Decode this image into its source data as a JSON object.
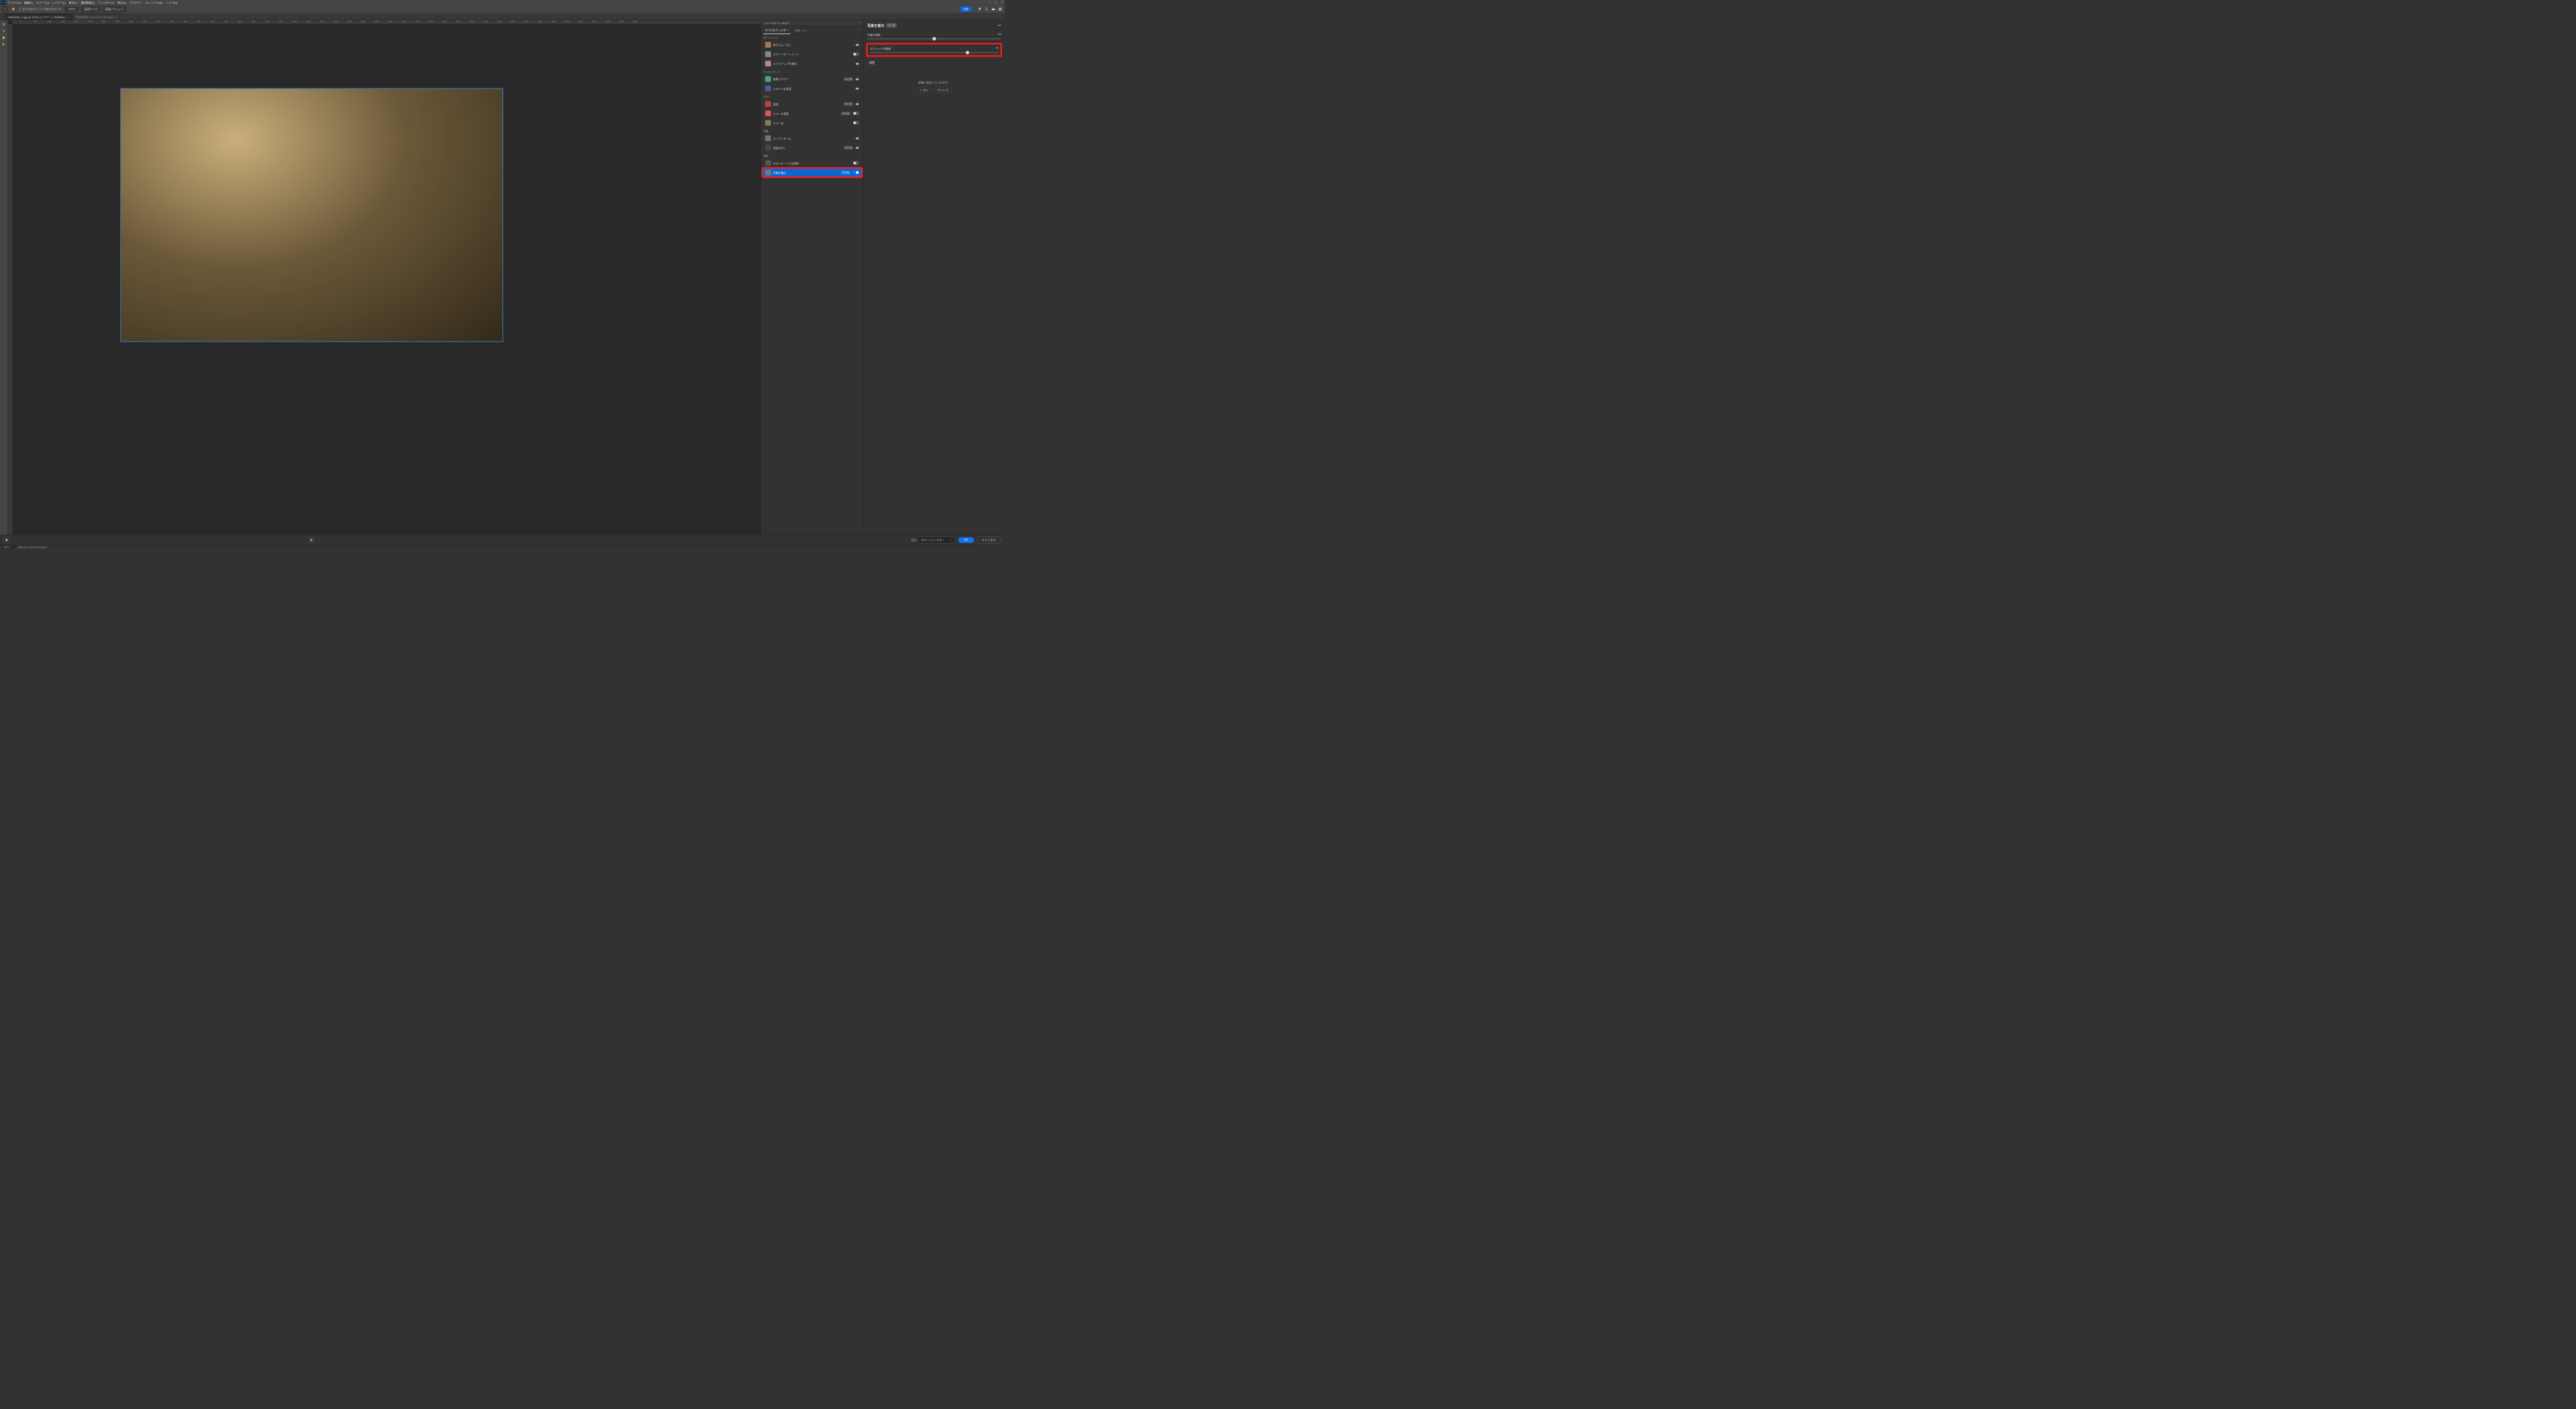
{
  "menubar": {
    "items": [
      "ファイル(F)",
      "編集(E)",
      "イメージ(I)",
      "レイヤー(L)",
      "書式(Y)",
      "選択範囲(S)",
      "フィルター(T)",
      "表示(V)",
      "プラグイン",
      "ウィンドウ(W)",
      "ヘルプ(H)"
    ]
  },
  "optionsbar": {
    "scroll_all_label": "すべてのウィンドウをスクロール",
    "zoom_value": "100%",
    "btn_fit_screen": "画面サイズ",
    "btn_fit": "画面にフィット",
    "share": "共有"
  },
  "tabs": [
    {
      "label": "26309439_m.jpg @ 100% (レイヤー 1, RGB/8#) *",
      "active": true
    },
    {
      "label": "名称未設定 1 @ 33.3% (RGB/8#)",
      "active": false
    }
  ],
  "ruler_marks": [
    0,
    50,
    100,
    150,
    200,
    250,
    300,
    350,
    400,
    450,
    500,
    550,
    600,
    650,
    700,
    750,
    800,
    850,
    900,
    950,
    1000,
    1050,
    1100,
    1150,
    1200,
    1250,
    1300,
    1350,
    1400,
    1450,
    1500,
    1550,
    1600,
    1650,
    1700,
    1750,
    1800,
    1850,
    1900,
    1950,
    2000,
    2050,
    2100,
    2150,
    2200,
    2250
  ],
  "neural": {
    "panel_title": "ニューラルフィルター",
    "tab_all": "すべてのフィルター",
    "tab_wait": "待機リスト",
    "categories": [
      {
        "name": "ポートレート",
        "key": "portrait",
        "items": [
          {
            "label": "肌をスムーズに",
            "beta": false,
            "toggle": null,
            "cloud": true,
            "thumb": "#a07a60"
          },
          {
            "label": "スマートポートレート",
            "beta": false,
            "toggle": false,
            "cloud": false,
            "thumb": "#888"
          },
          {
            "label": "メイクアップを適用",
            "beta": false,
            "toggle": null,
            "cloud": true,
            "thumb": "#b88"
          }
        ]
      },
      {
        "name": "クリエイティブ",
        "key": "creative",
        "items": [
          {
            "label": "風景ミキサー",
            "beta": true,
            "toggle": null,
            "cloud": true,
            "thumb": "#4a7"
          },
          {
            "label": "スタイルの適用",
            "beta": false,
            "toggle": null,
            "cloud": true,
            "thumb": "#559"
          }
        ]
      },
      {
        "name": "カラー",
        "key": "color",
        "items": [
          {
            "label": "調和",
            "beta": true,
            "toggle": null,
            "cloud": true,
            "thumb": "#b44"
          },
          {
            "label": "カラーの適用",
            "beta": true,
            "toggle": false,
            "cloud": false,
            "thumb": "#d55"
          },
          {
            "label": "カラー化",
            "beta": false,
            "toggle": false,
            "cloud": false,
            "thumb": "#876"
          }
        ]
      },
      {
        "name": "写真",
        "key": "photo",
        "items": [
          {
            "label": "スーパーズーム",
            "beta": false,
            "toggle": null,
            "cloud": true,
            "thumb": "#678"
          },
          {
            "label": "深度ぼかし",
            "beta": true,
            "toggle": null,
            "cloud": true,
            "thumb": "#445"
          }
        ]
      },
      {
        "name": "復元",
        "key": "restore",
        "items": [
          {
            "label": "JPEG のノイズを削除",
            "beta": false,
            "toggle": false,
            "cloud": false,
            "thumb": "#555"
          },
          {
            "label": "写真を復元",
            "beta": true,
            "toggle": true,
            "cloud": false,
            "thumb": "#777",
            "active": true,
            "red": true
          }
        ]
      }
    ]
  },
  "controls": {
    "title": "写真を復元",
    "beta": "ベータ",
    "sliders": [
      {
        "label": "写真の強調",
        "value": 50,
        "pos": 50,
        "red": false
      },
      {
        "label": "スクラッチの軽減",
        "value": 76,
        "pos": 76,
        "red": true
      }
    ],
    "expand": "調整",
    "satisfy_q": "結果に満足していますか？",
    "yes": "はい",
    "no": "いいえ"
  },
  "bottombar": {
    "output_label": "出力",
    "output_value": "スマートフィルター",
    "ok": "OK",
    "cancel": "キャンセル"
  },
  "statusbar": {
    "zoom": "100%",
    "doc": "1920 px x 1275 px (72 ppi)"
  }
}
